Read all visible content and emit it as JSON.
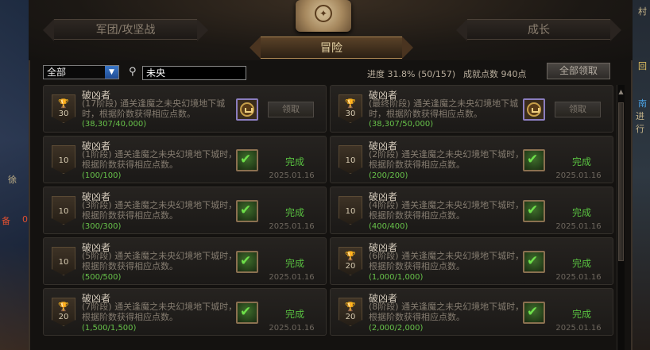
{
  "tabs": {
    "left": "军团/攻坚战",
    "center": "冒险",
    "right": "成长"
  },
  "filter": {
    "selected": "全部"
  },
  "search": {
    "value": "未央"
  },
  "stats": {
    "progress": "进度 31.8% (50/157)",
    "points": "成就点数 940点"
  },
  "claim_all_label": "全部领取",
  "background_fragments": [
    "徐",
    "备",
    "0",
    "村",
    "南",
    "进行",
    "回"
  ],
  "cards": [
    {
      "title": "破凶者",
      "desc": "(17阶段) 通关逢魔之未央幻境地下城时，根据阶数获得相应点数。",
      "progress": "(38,307/40,000)",
      "points": "30",
      "trophy": true,
      "status": "claim",
      "button": "领取",
      "date": ""
    },
    {
      "title": "破凶者",
      "desc": "(最终阶段) 通关逢魔之未央幻境地下城时，根据阶数获得相应点数。",
      "progress": "(38,307/50,000)",
      "points": "30",
      "trophy": true,
      "status": "claim",
      "button": "领取",
      "date": ""
    },
    {
      "title": "破凶者",
      "desc": "(1阶段) 通关逢魔之未央幻境地下城时，根据阶数获得相应点数。",
      "progress": "(100/100)",
      "points": "10",
      "trophy": false,
      "status": "done",
      "button": "完成",
      "date": "2025.01.16"
    },
    {
      "title": "破凶者",
      "desc": "(2阶段) 通关逢魔之未央幻境地下城时，根据阶数获得相应点数。",
      "progress": "(200/200)",
      "points": "10",
      "trophy": false,
      "status": "done",
      "button": "完成",
      "date": "2025.01.16"
    },
    {
      "title": "破凶者",
      "desc": "(3阶段) 通关逢魔之未央幻境地下城时，根据阶数获得相应点数。",
      "progress": "(300/300)",
      "points": "10",
      "trophy": false,
      "status": "done",
      "button": "完成",
      "date": "2025.01.16"
    },
    {
      "title": "破凶者",
      "desc": "(4阶段) 通关逢魔之未央幻境地下城时，根据阶数获得相应点数。",
      "progress": "(400/400)",
      "points": "10",
      "trophy": false,
      "status": "done",
      "button": "完成",
      "date": "2025.01.16"
    },
    {
      "title": "破凶者",
      "desc": "(5阶段) 通关逢魔之未央幻境地下城时，根据阶数获得相应点数。",
      "progress": "(500/500)",
      "points": "10",
      "trophy": false,
      "status": "done",
      "button": "完成",
      "date": "2025.01.16"
    },
    {
      "title": "破凶者",
      "desc": "(6阶段) 通关逢魔之未央幻境地下城时，根据阶数获得相应点数。",
      "progress": "(1,000/1,000)",
      "points": "20",
      "trophy": true,
      "status": "done",
      "button": "完成",
      "date": "2025.01.16"
    },
    {
      "title": "破凶者",
      "desc": "(7阶段) 通关逢魔之未央幻境地下城时，根据阶数获得相应点数。",
      "progress": "(1,500/1,500)",
      "points": "20",
      "trophy": true,
      "status": "done",
      "button": "完成",
      "date": "2025.01.16"
    },
    {
      "title": "破凶者",
      "desc": "(8阶段) 通关逢魔之未央幻境地下城时，根据阶数获得相应点数。",
      "progress": "(2,000/2,000)",
      "points": "20",
      "trophy": true,
      "status": "done",
      "button": "完成",
      "date": "2025.01.16"
    }
  ]
}
